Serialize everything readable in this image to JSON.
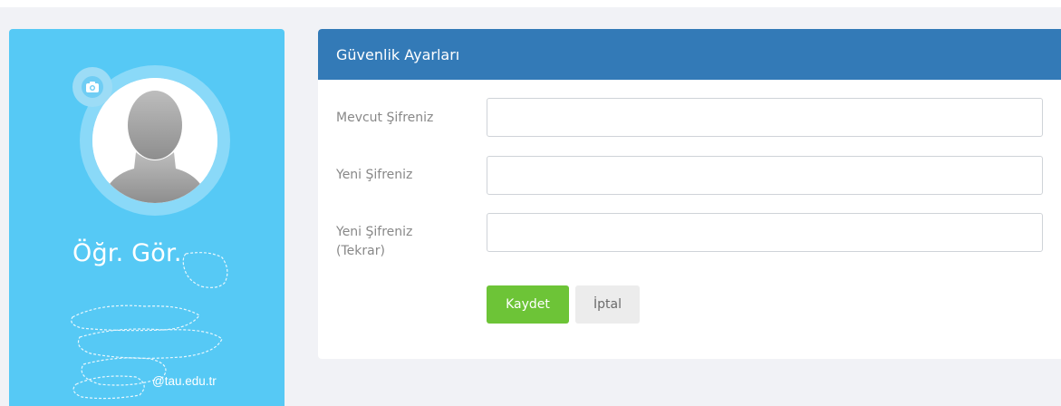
{
  "profile": {
    "title": "Öğr. Gör.",
    "email_suffix": "@tau.edu.tr",
    "camera_icon": "camera-icon",
    "avatar_icon": "user-silhouette-icon"
  },
  "security": {
    "panel_title": "Güvenlik Ayarları",
    "fields": [
      {
        "label": "Mevcut Şifreniz",
        "value": ""
      },
      {
        "label": "Yeni Şifreniz",
        "value": ""
      },
      {
        "label": "Yeni Şifreniz (Tekrar)",
        "value": ""
      }
    ],
    "save_label": "Kaydet",
    "cancel_label": "İptal"
  },
  "colors": {
    "profile_bg": "#56c9f5",
    "panel_header": "#337ab7",
    "save_button": "#6dc437",
    "cancel_button": "#ececec",
    "page_bg": "#f1f2f6"
  }
}
